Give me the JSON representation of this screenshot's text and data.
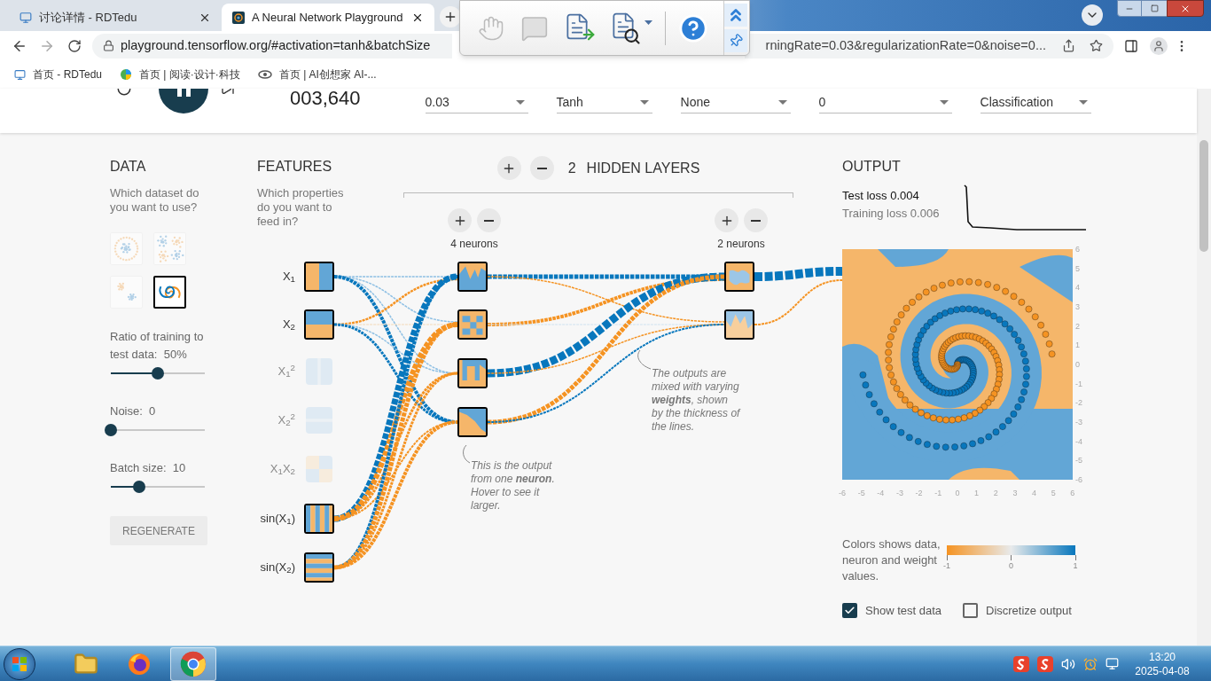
{
  "browser": {
    "tabs": [
      {
        "title": "讨论详情 - RDTedu",
        "selected": false
      },
      {
        "title": "A Neural Network Playground",
        "selected": true
      }
    ],
    "url_start": "playground.tensorflow.org/#activation=tanh&batchSize",
    "url_end": "rningRate=0.03&regularizationRate=0&noise=0...",
    "bookmarks": [
      "首页 - RDTedu",
      "首页 | 阅读·设计·科技",
      "首页 | AI创想家 AI-..."
    ]
  },
  "controls": {
    "playing": true,
    "epoch": "003,640",
    "dropdowns": [
      "0.03",
      "Tanh",
      "None",
      "0",
      "Classification"
    ]
  },
  "data": {
    "heading": "DATA",
    "prompt": "Which dataset do you want to use?",
    "datasets": [
      {
        "kind": "circle",
        "selected": false
      },
      {
        "kind": "xor",
        "selected": false
      },
      {
        "kind": "gauss",
        "selected": false
      },
      {
        "kind": "spiral",
        "selected": true
      }
    ],
    "sliders": [
      {
        "label": "Ratio of training to test data:",
        "reading": "50%",
        "level": 0.5
      },
      {
        "label": "Noise:",
        "reading": "0",
        "level": 0
      },
      {
        "label": "Batch size:",
        "reading": "10",
        "level": 0.3
      }
    ],
    "regenerate": "REGENERATE"
  },
  "features": {
    "heading": "FEATURES",
    "prompt": "Which properties do you want to feed in?",
    "items": [
      {
        "label": "X$_{1}$",
        "kind": "x1",
        "enabled": true
      },
      {
        "label": "X$_{2}$",
        "kind": "x2",
        "enabled": true
      },
      {
        "label": "X$_{1}$$^{2}$",
        "kind": "x1sq",
        "enabled": false
      },
      {
        "label": "X$_{2}$$^{2}$",
        "kind": "x2sq",
        "enabled": false
      },
      {
        "label": "X$_{1}$X$_{2}$",
        "kind": "x1x2",
        "enabled": false
      },
      {
        "label": "sin(X$_{1}$)",
        "kind": "sinx1",
        "enabled": true
      },
      {
        "label": "sin(X$_{2}$)",
        "kind": "sinx2",
        "enabled": true
      }
    ]
  },
  "network": {
    "layer_count": "2",
    "layers_label": "HIDDEN LAYERS",
    "layers": [
      {
        "neurons_label": "4 neurons"
      },
      {
        "neurons_label": "2 neurons"
      }
    ],
    "annotations": [
      "This is the output from one **neuron**. Hover to see it larger.",
      "The outputs are mixed with varying **weights**, shown by the thickness of the lines."
    ]
  },
  "output": {
    "heading": "OUTPUT",
    "test_loss": "Test loss 0.004",
    "training_loss": "Training loss 0.006",
    "y_ticks": [
      "6",
      "5",
      "4",
      "3",
      "2",
      "1",
      "0",
      "-1",
      "-2",
      "-3",
      "-4",
      "-5",
      "-6"
    ],
    "x_ticks": [
      "-6",
      "-5",
      "-4",
      "-3",
      "-2",
      "-1",
      "0",
      "1",
      "2",
      "3",
      "4",
      "5",
      "6"
    ],
    "legend_text": "Colors shows data, neuron and weight values.",
    "legend_ticks": [
      "-1",
      "0",
      "1"
    ],
    "checkboxes": [
      {
        "label": "Show test data",
        "checked": true
      },
      {
        "label": "Discretize output",
        "checked": false
      }
    ]
  },
  "taskbar": {
    "time": "13:20",
    "date": "2025-04-08"
  }
}
